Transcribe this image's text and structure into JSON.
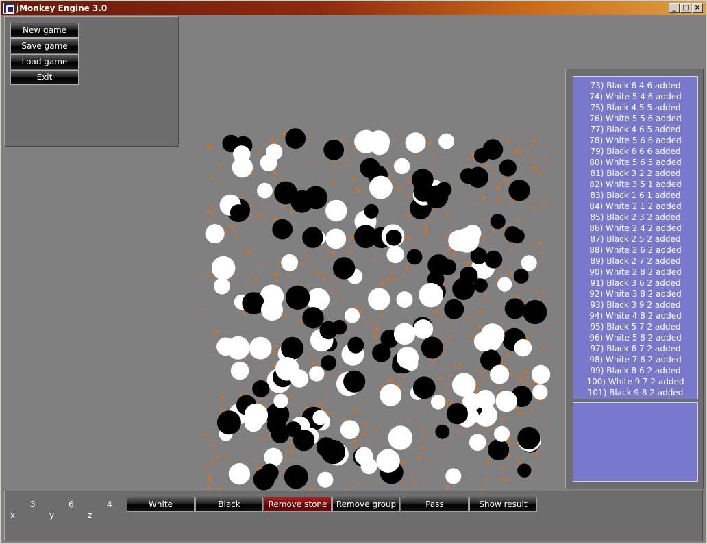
{
  "window": {
    "title": "jMonkey Engine 3.0"
  },
  "menu": {
    "new_game": "New game",
    "save_game": "Save game",
    "load_game": "Load game",
    "exit": "Exit"
  },
  "log": [
    "73) Black 6 4 6 added",
    "74) White 5 4 6 added",
    "75) Black 4 5 5 added",
    "76) White 5 5 6 added",
    "77) Black 4 6 5 added",
    "78) White 5 6 6 added",
    "79) Black 6 6 6 added",
    "80) White 5 6 5 added",
    "81) Black 3 2 2 added",
    "82) White 3 5 1 added",
    "83) Black 1 6 1 added",
    "84) White 2 1 2 added",
    "85) Black 2 3 2 added",
    "86) White 2 4 2 added",
    "87) Black 2 5 2 added",
    "88) White 2 6 2 added",
    "89) Black 2 7 2 added",
    "90) White 2 8 2 added",
    "91) Black 3 6 2 added",
    "92) White 3 8 2 added",
    "93) Black 3 9 2 added",
    "94) White 4 8 2 added",
    "95) Black 5 7 2 added",
    "96) White 5 8 2 added",
    "97) Black 6 7 2 added",
    "98) White 7 6 2 added",
    "99) Black 8 6 2 added",
    "100) White 9 7 2 added",
    "101) Black 9 8 2 added"
  ],
  "coords": {
    "x": "3",
    "y": "6",
    "z": "4",
    "x_label": "x",
    "y_label": "y",
    "z_label": "z"
  },
  "actions": {
    "white": "White",
    "black": "Black",
    "remove_stone": "Remove stone",
    "remove_group": "Remove group",
    "pass": "Pass",
    "show_result": "Show result"
  },
  "colors": {
    "white_stone": "#ffffff",
    "black_stone": "#000000",
    "grid_point": "#e07010",
    "active_button": "#8b0f0f"
  }
}
